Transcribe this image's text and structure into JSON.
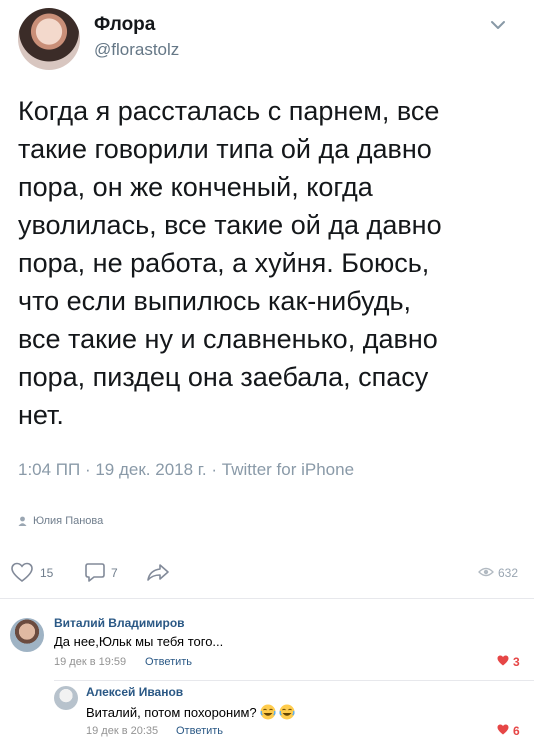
{
  "tweet": {
    "display_name": "Флора",
    "handle": "@florastolz",
    "text": "Когда я рассталась с парнем, все\nтакие говорили типа ой да давно\nпора, он же конченый, когда\nуволилась, все такие ой да давно\nпора, не работа, а хуйня. Боюсь,\nчто если выпилюсь как-нибудь,\nвсе такие ну и славненько, давно\nпора, пиздец она заебала, спасу\nнет.",
    "meta": "1:04 ПП · 19 дек. 2018 г. · Twitter for iPhone"
  },
  "post": {
    "author": "Юлия Панова",
    "likes": "15",
    "comments": "7",
    "views": "632"
  },
  "comments": [
    {
      "name": "Виталий Владимиров",
      "text": "Да нее,Юльк мы тебя того...",
      "date": "19 дек в 19:59",
      "reply_label": "Ответить",
      "likes": "3"
    },
    {
      "name": "Алексей Иванов",
      "text": "Виталий, потом похороним?",
      "date": "19 дек в 20:35",
      "reply_label": "Ответить",
      "likes": "6"
    }
  ],
  "colors": {
    "vk_link": "#2a5885",
    "like_red": "#e64646",
    "twitter_gray": "#657786"
  },
  "icons": [
    "chevron-down-icon",
    "user-icon",
    "heart-icon",
    "comment-icon",
    "share-icon",
    "eye-icon",
    "laughing-emoji-icon"
  ]
}
